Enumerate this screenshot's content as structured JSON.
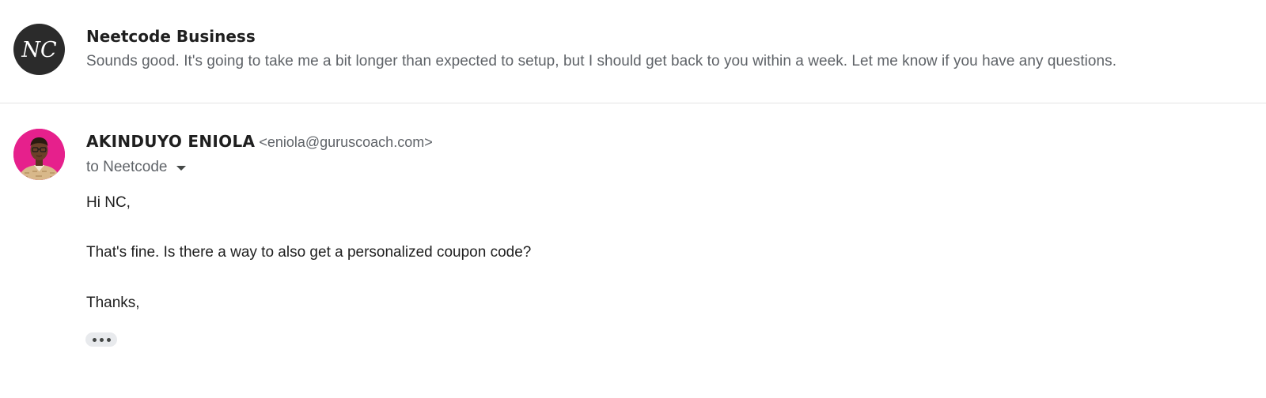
{
  "collapsed_message": {
    "avatar_initials": "NC",
    "sender": "Neetcode Business",
    "snippet": "Sounds good. It's going to take me a bit longer than expected to setup, but I should get back to you within a week. Let me know if you have any questions."
  },
  "expanded_message": {
    "sender_name": "AKINDUYO ENIOLA",
    "sender_email": "<eniola@guruscoach.com>",
    "recipient": "to Neetcode",
    "body_lines": [
      "Hi NC,",
      "That's fine. Is there a way to also get a personalized coupon code?",
      "Thanks,"
    ],
    "show_trimmed_icon": "more-horiz-icon"
  },
  "colors": {
    "nc_avatar_bg": "#2b2b2b",
    "photo_avatar_bg": "#e6208c",
    "divider": "#e3e3e3",
    "secondary_text": "#5f6368",
    "primary_text": "#1f1f1f"
  }
}
